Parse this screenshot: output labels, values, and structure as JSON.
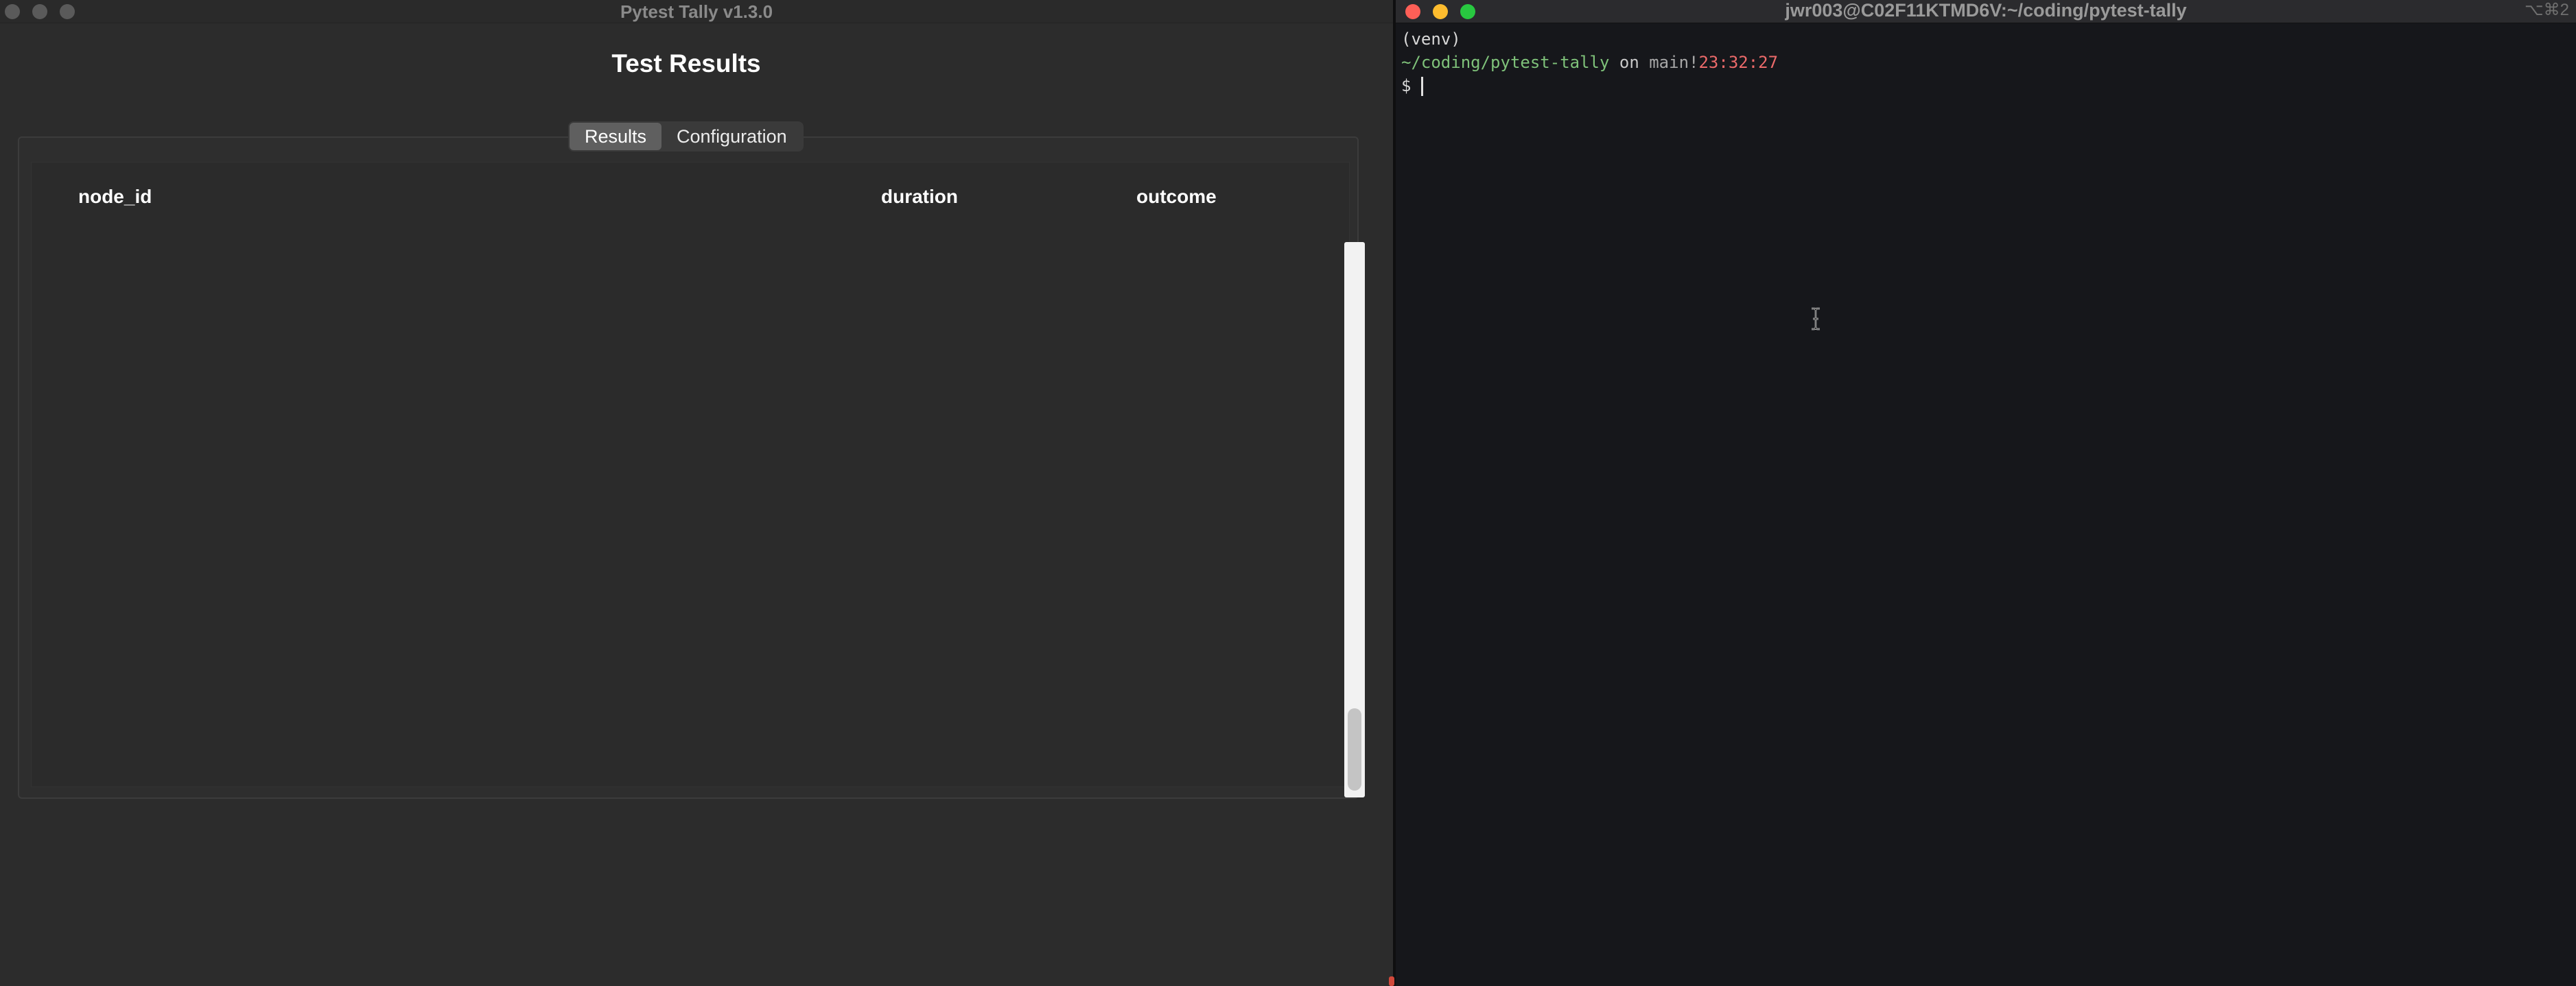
{
  "tally_window": {
    "title": "Pytest Tally v1.3.0",
    "heading": "Test Results",
    "tabs": [
      {
        "label": "Results",
        "active": true
      },
      {
        "label": "Configuration",
        "active": false
      }
    ],
    "table": {
      "columns": [
        "node_id",
        "duration",
        "outcome"
      ],
      "rows": []
    }
  },
  "terminal_window": {
    "title": "jwr003@C02F11KTMD6V:~/coding/pytest-tally",
    "shortcut": "⌥⌘2",
    "lines": {
      "venv": "(venv)",
      "path": "~/coding/pytest-tally",
      "on": " on ",
      "branch_icon": "",
      "branch": "main!",
      "clock_icon": "",
      "time": "23:32:27",
      "prompt": "$ "
    }
  },
  "colors": {
    "accent_green": "#7fc27a",
    "accent_red": "#ec6a6a",
    "close": "#fe5f57",
    "minimize": "#febc2e",
    "zoom": "#28c840"
  }
}
